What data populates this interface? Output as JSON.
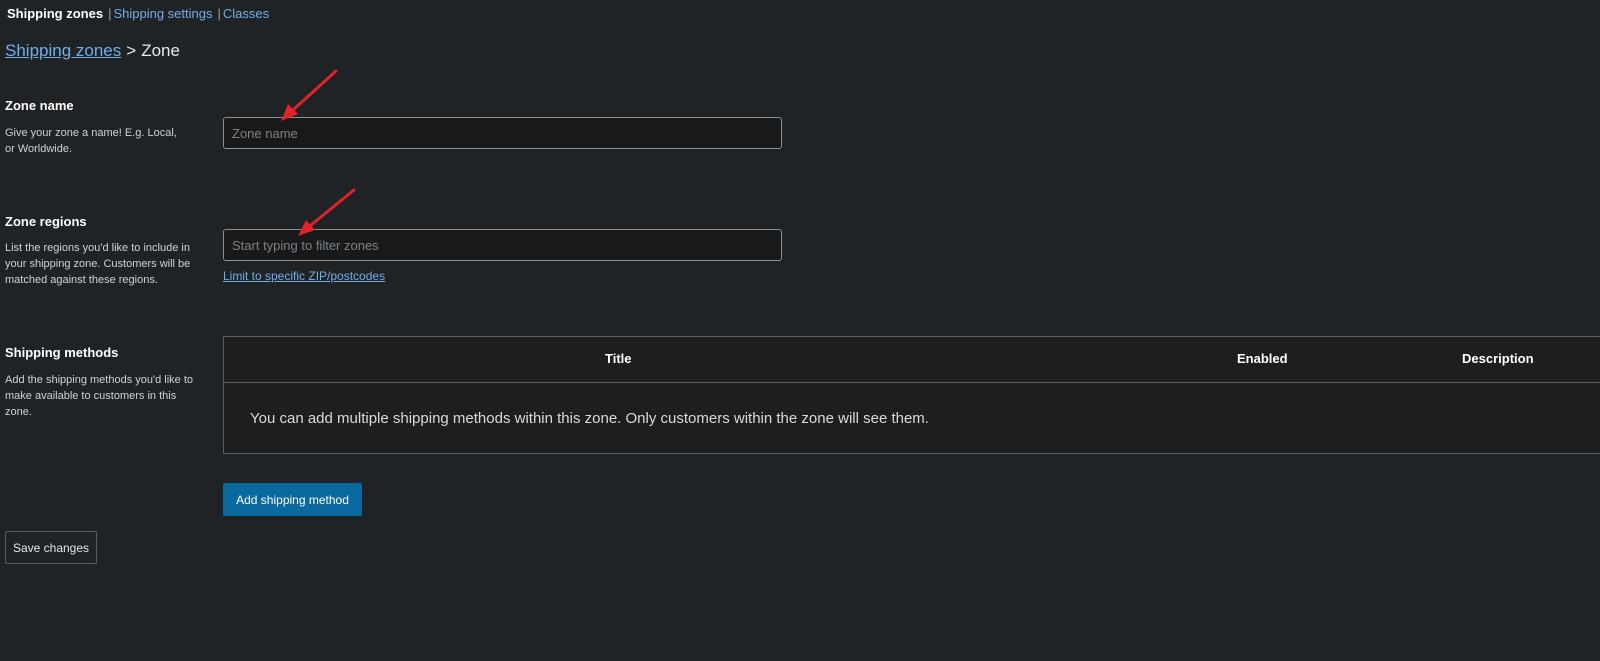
{
  "subnav": {
    "current": "Shipping zones",
    "links": [
      "Shipping settings",
      "Classes"
    ],
    "separator": "|"
  },
  "breadcrumb": {
    "parent": "Shipping zones",
    "separator": ">",
    "current": "Zone"
  },
  "zone_name": {
    "title": "Zone name",
    "description": "Give your zone a name! E.g. Local, or Worldwide.",
    "input_value": "",
    "input_placeholder": "Zone name"
  },
  "zone_regions": {
    "title": "Zone regions",
    "description": "List the regions you'd like to include in your shipping zone. Customers will be matched against these regions.",
    "input_value": "",
    "input_placeholder": "Start typing to filter zones",
    "postcode_link": "Limit to specific ZIP/postcodes"
  },
  "shipping_methods": {
    "title": "Shipping methods",
    "description": "Add the shipping methods you'd like to make available to customers in this zone.",
    "columns": {
      "title": "Title",
      "enabled": "Enabled",
      "description": "Description"
    },
    "empty_message": "You can add multiple shipping methods within this zone. Only customers within the zone will see them.",
    "add_button": "Add shipping method"
  },
  "actions": {
    "save_button": "Save changes"
  },
  "colors": {
    "background": "#202326",
    "link": "#72aee6",
    "primary_button": "#0a6aa0",
    "annotation_arrow": "#e0222a"
  }
}
